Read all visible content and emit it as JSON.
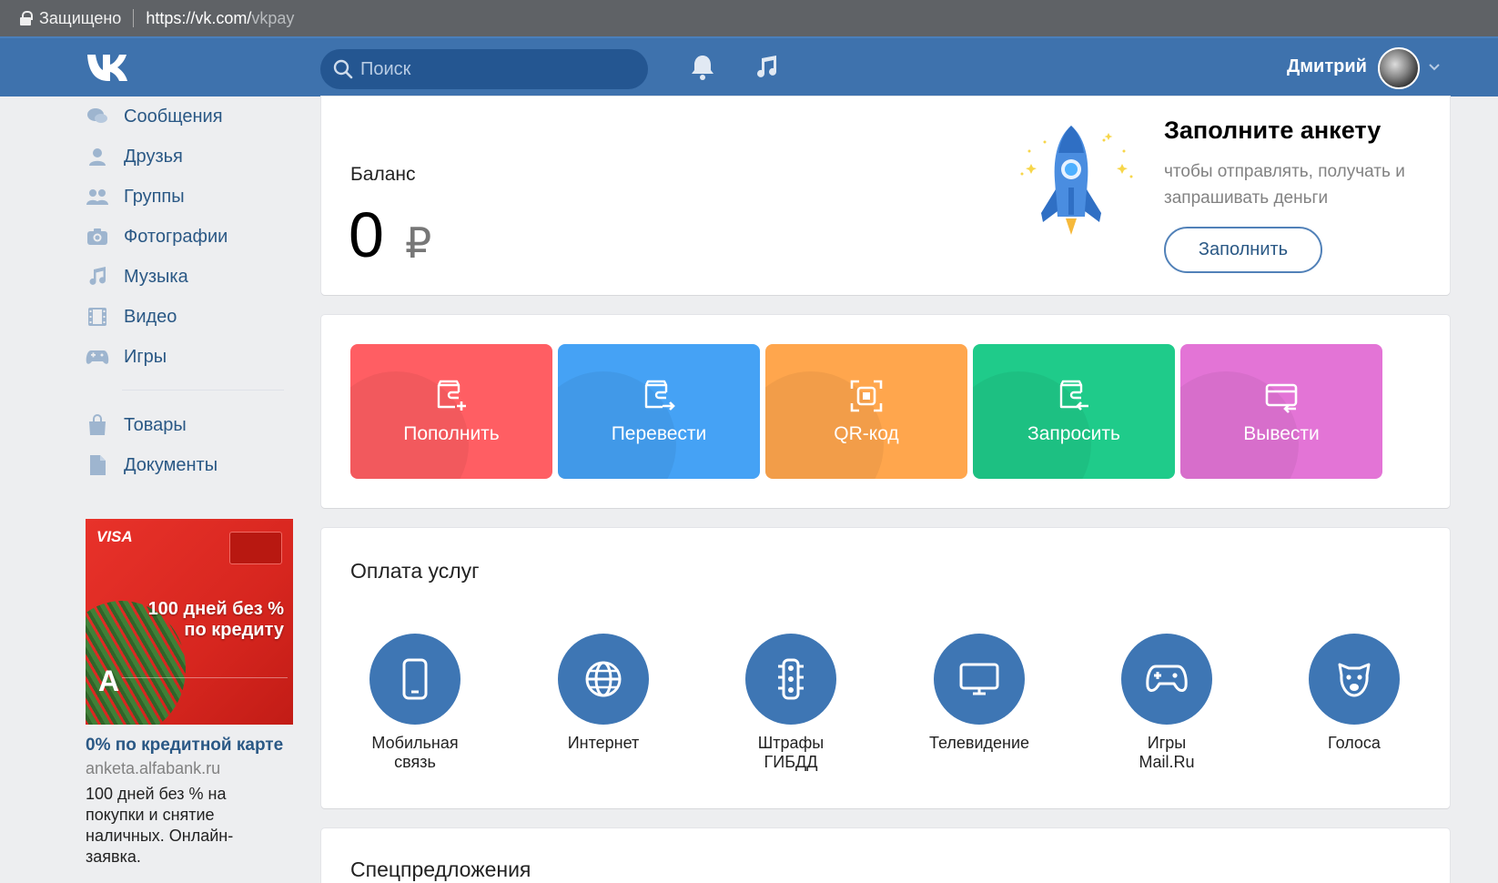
{
  "browser": {
    "security_label": "Защищено",
    "url_host": "https://vk.com/",
    "url_path": "vkpay"
  },
  "header": {
    "search_placeholder": "Поиск",
    "user_name": "Дмитрий"
  },
  "sidebar": {
    "items": [
      {
        "label": "Сообщения",
        "icon": "messages-icon"
      },
      {
        "label": "Друзья",
        "icon": "friends-icon"
      },
      {
        "label": "Группы",
        "icon": "groups-icon"
      },
      {
        "label": "Фотографии",
        "icon": "photos-icon"
      },
      {
        "label": "Музыка",
        "icon": "music-icon"
      },
      {
        "label": "Видео",
        "icon": "video-icon"
      },
      {
        "label": "Игры",
        "icon": "games-icon"
      }
    ],
    "items2": [
      {
        "label": "Товары",
        "icon": "goods-icon"
      },
      {
        "label": "Документы",
        "icon": "documents-icon"
      }
    ]
  },
  "ad": {
    "visa": "VISA",
    "headline_1": "100 дней без %",
    "headline_2": "по кредиту",
    "bank_letter": "А",
    "title": "0% по кредитной карте",
    "domain": "anketa.alfabank.ru",
    "description": "100 дней без % на покупки и снятие наличных. Онлайн-заявка."
  },
  "balance": {
    "label": "Баланс",
    "value": "0",
    "currency": "₽"
  },
  "promo": {
    "title": "Заполните анкету",
    "text": "чтобы отправлять, получать и запрашивать деньги",
    "button": "Заполнить"
  },
  "actions": [
    {
      "label": "Пополнить",
      "color": "#ff5e63",
      "icon": "wallet-plus-icon"
    },
    {
      "label": "Перевести",
      "color": "#45a2f5",
      "icon": "wallet-send-icon"
    },
    {
      "label": "QR-код",
      "color": "#ffa64d",
      "icon": "qr-scan-icon"
    },
    {
      "label": "Запросить",
      "color": "#1fcb8a",
      "icon": "wallet-request-icon"
    },
    {
      "label": "Вывести",
      "color": "#e374d6",
      "icon": "card-withdraw-icon"
    }
  ],
  "services": {
    "title": "Оплата услуг",
    "items": [
      {
        "label": "Мобильная\nсвязь",
        "icon": "mobile-phone-icon"
      },
      {
        "label": "Интернет",
        "icon": "globe-icon"
      },
      {
        "label": "Штрафы\nГИБДД",
        "icon": "traffic-light-icon"
      },
      {
        "label": "Телевидение",
        "icon": "tv-icon"
      },
      {
        "label": "Игры\nMail.Ru",
        "icon": "gamepad-icon"
      },
      {
        "label": "Голоса",
        "icon": "vk-votes-icon"
      }
    ]
  },
  "offers": {
    "title": "Спецпредложения"
  }
}
